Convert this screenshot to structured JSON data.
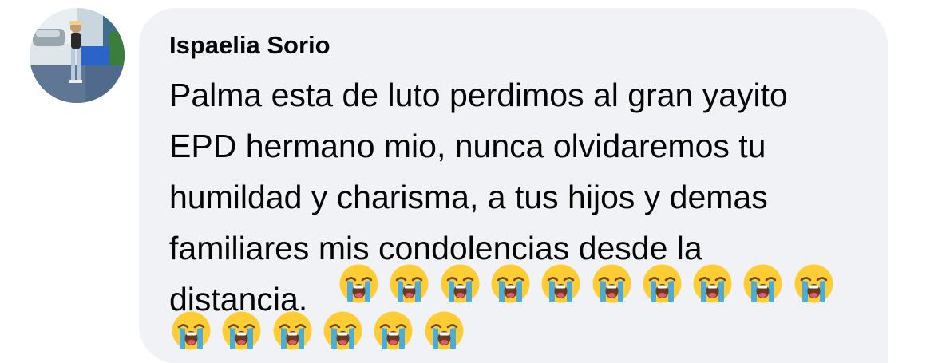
{
  "comment": {
    "author_name": "Ispaelia Sorio",
    "text": "Palma esta de luto perdimos al gran yayito\nEPD hermano mio, nunca olvidaremos tu\nhumildad y charisma, a tus hijos y demas\nfamiliares mis condolencias desde la\ndistancia.",
    "emoji_name": "loudly-crying-face-icon",
    "emoji_count": 16,
    "emoji_row1_count": 10,
    "emoji_row2_count": 6
  },
  "colors": {
    "bubble_background": "#f0f2f5",
    "text": "#050505",
    "emoji_face": "#ffcc33",
    "emoji_tears": "#3aa8e8"
  }
}
